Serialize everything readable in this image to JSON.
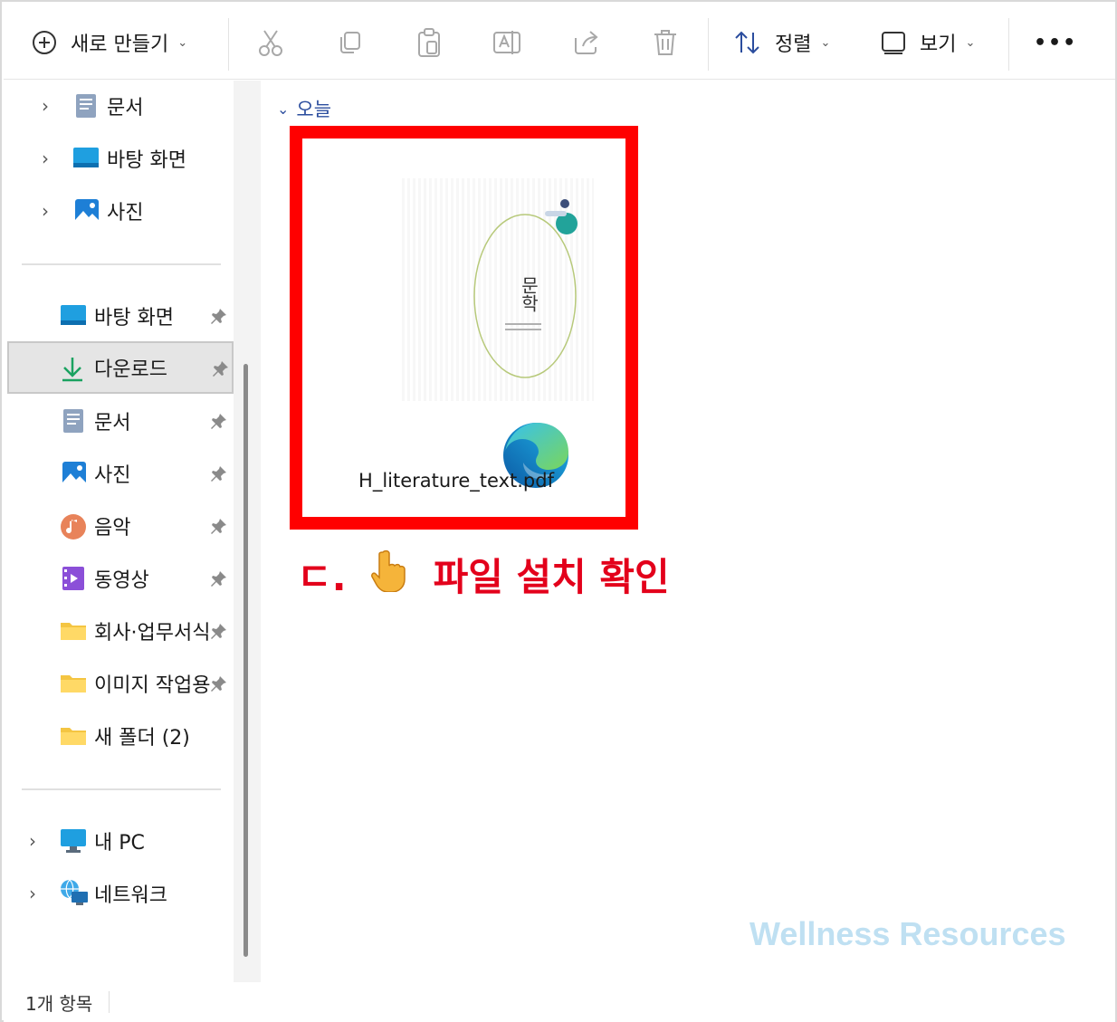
{
  "toolbar": {
    "new_label": "새로 만들기",
    "sort_label": "정렬",
    "view_label": "보기",
    "more_label": "•••"
  },
  "sidebar": {
    "quick_top": [
      {
        "label": "문서",
        "icon": "document-icon"
      },
      {
        "label": "바탕 화면",
        "icon": "desktop-icon"
      },
      {
        "label": "사진",
        "icon": "pictures-icon"
      }
    ],
    "pinned": [
      {
        "label": "바탕 화면",
        "icon": "desktop-icon",
        "pinned": true
      },
      {
        "label": "다운로드",
        "icon": "download-icon",
        "pinned": true,
        "selected": true
      },
      {
        "label": "문서",
        "icon": "document-icon",
        "pinned": true
      },
      {
        "label": "사진",
        "icon": "pictures-icon",
        "pinned": true
      },
      {
        "label": "음악",
        "icon": "music-icon",
        "pinned": true
      },
      {
        "label": "동영상",
        "icon": "video-icon",
        "pinned": true
      },
      {
        "label": "회사·업무서식",
        "icon": "folder-icon",
        "pinned": true
      },
      {
        "label": "이미지 작업용",
        "icon": "folder-icon",
        "pinned": true
      },
      {
        "label": "새 폴더 (2)",
        "icon": "folder-icon",
        "pinned": false
      }
    ],
    "bottom": [
      {
        "label": "내 PC",
        "icon": "pc-icon"
      },
      {
        "label": "네트워크",
        "icon": "network-icon"
      }
    ]
  },
  "content": {
    "group_label": "오늘",
    "file": {
      "name": "H_literature_text.pdf",
      "thumbnail_title": "문학",
      "app_icon": "edge-icon"
    },
    "callout": {
      "prefix": "ㄷ.",
      "text": "파일 설치 확인",
      "icon": "pointing-hand-icon"
    },
    "watermark": "Wellness Resources"
  },
  "status": {
    "item_count": "1개 항목"
  },
  "colors": {
    "highlight_border": "#ff0000",
    "callout_text": "#e3001b",
    "group_header": "#2b4d9e",
    "watermark": "#bfe0f2",
    "selected_bg": "#e5e5e5"
  }
}
